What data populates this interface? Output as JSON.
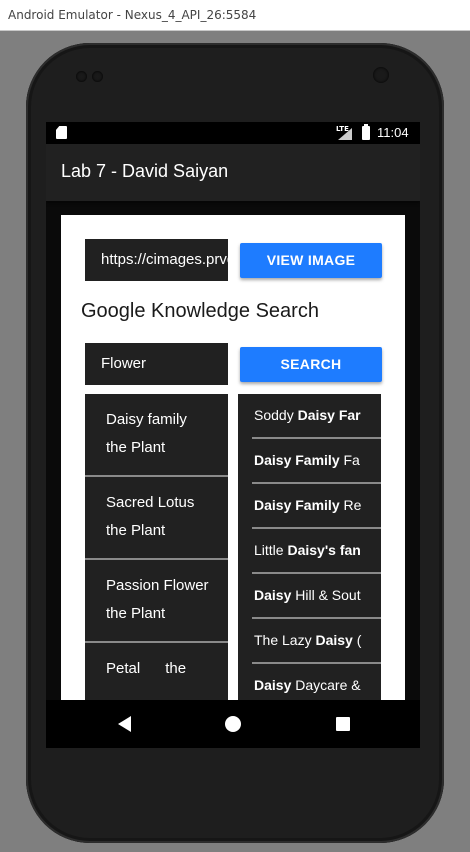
{
  "window": {
    "title": "Android Emulator - Nexus_4_API_26:5584"
  },
  "status_bar": {
    "network": "LTE",
    "time": "11:04"
  },
  "app_bar": {
    "title": "Lab 7 - David Saiyan"
  },
  "image_row": {
    "url_value": "https://cimages.prvd.com",
    "view_button": "VIEW IMAGE"
  },
  "knowledge": {
    "heading": "Google Knowledge Search",
    "query": "Flower",
    "search_button": "SEARCH"
  },
  "left_results": [
    {
      "line1": "Daisy family",
      "line2": "the Plant"
    },
    {
      "line1": "Sacred Lotus",
      "line2": "the Plant"
    },
    {
      "line1": "Passion Flower",
      "line2": "the Plant"
    },
    {
      "line1": "Petal      the",
      "line2": ""
    }
  ],
  "right_results": [
    {
      "pre": "Soddy ",
      "bold": "Daisy Far",
      "post": ""
    },
    {
      "pre": "",
      "bold": "Daisy Family",
      "post": " Fa"
    },
    {
      "pre": "",
      "bold": "Daisy Family",
      "post": " Re"
    },
    {
      "pre": "Little ",
      "bold": "Daisy's fan",
      "post": ""
    },
    {
      "pre": "",
      "bold": "Daisy",
      "post": " Hill & Sout"
    },
    {
      "pre": "The Lazy ",
      "bold": "Daisy",
      "post": " ("
    },
    {
      "pre": "",
      "bold": "Daisy",
      "post": " Daycare &"
    }
  ],
  "nav_icons": [
    "back-icon",
    "home-icon",
    "recent-apps-icon"
  ]
}
